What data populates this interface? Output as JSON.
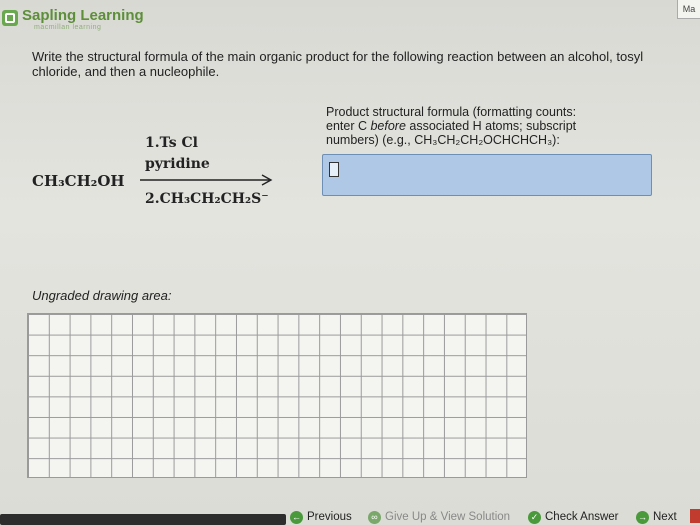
{
  "header": {
    "brand": "Sapling Learning",
    "tagline": "macmillan learning",
    "corner_label": "Ma"
  },
  "question": {
    "text": "Write the structural formula of the main organic product for the following reaction between an alcohol, tosyl chloride, and then a nucleophile."
  },
  "reaction": {
    "reactant": "CH₃CH₂OH",
    "step1_reagent": "1.Ts Cl",
    "step1_solvent": "pyridine",
    "step2_reagent": "2.CH₃CH₂CH₂S⁻"
  },
  "answer": {
    "label_line1": "Product structural formula (formatting counts:",
    "label_line2_pre": "enter C ",
    "label_line2_em": "before",
    "label_line2_post": " associated H atoms; subscript",
    "label_line3": "numbers) (e.g., CH₃CH₂CH₂OCHCHCH₃):",
    "value": ""
  },
  "drawing": {
    "label": "Ungraded drawing area:"
  },
  "footer": {
    "previous": "Previous",
    "give_up": "Give Up & View Solution",
    "check_answer": "Check Answer",
    "next": "Next"
  },
  "colors": {
    "brand_green": "#5d8f3a",
    "answer_box": "#aec8e6"
  }
}
